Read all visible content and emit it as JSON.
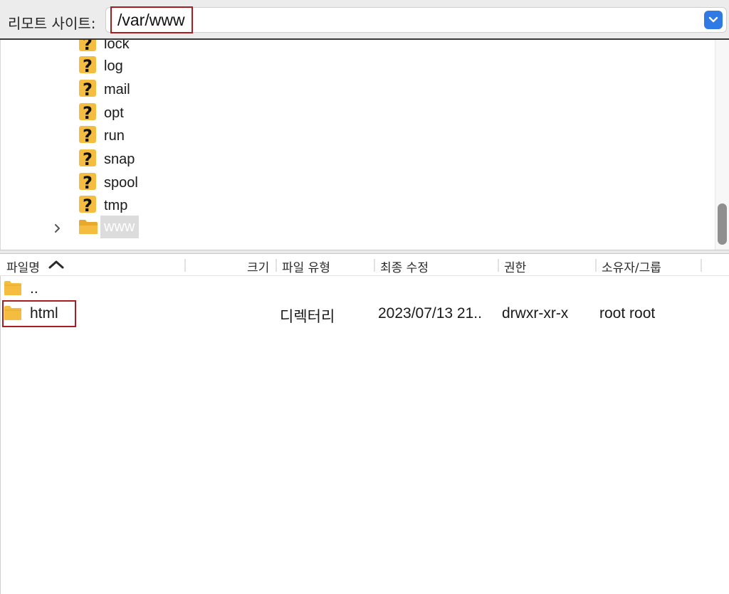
{
  "site_bar": {
    "label": "리모트 사이트:",
    "path_value": "/var/www"
  },
  "tree": {
    "items": [
      {
        "label": "lock",
        "icon": "unknown-folder-icon"
      },
      {
        "label": "log",
        "icon": "unknown-folder-icon"
      },
      {
        "label": "mail",
        "icon": "unknown-folder-icon"
      },
      {
        "label": "opt",
        "icon": "unknown-folder-icon"
      },
      {
        "label": "run",
        "icon": "unknown-folder-icon"
      },
      {
        "label": "snap",
        "icon": "unknown-folder-icon"
      },
      {
        "label": "spool",
        "icon": "unknown-folder-icon"
      },
      {
        "label": "tmp",
        "icon": "unknown-folder-icon"
      },
      {
        "label": "www",
        "icon": "folder-open-icon",
        "selected": true
      }
    ]
  },
  "file_list": {
    "columns": {
      "name": "파일명",
      "size": "크기",
      "type": "파일 유형",
      "modified": "최종 수정",
      "permissions": "권한",
      "owner": "소유자/그룹"
    },
    "rows": [
      {
        "name": "..",
        "size": "",
        "type": "",
        "modified": "",
        "permissions": "",
        "owner": ""
      },
      {
        "name": "html",
        "size": "",
        "type": "디렉터리",
        "modified": "2023/07/13 21..",
        "permissions": "drwxr-xr-x",
        "owner": "root root"
      }
    ]
  },
  "colors": {
    "highlight_border": "#a61e22",
    "folder": "#f5bd40",
    "dropdown_accent": "#2f7ae5"
  }
}
